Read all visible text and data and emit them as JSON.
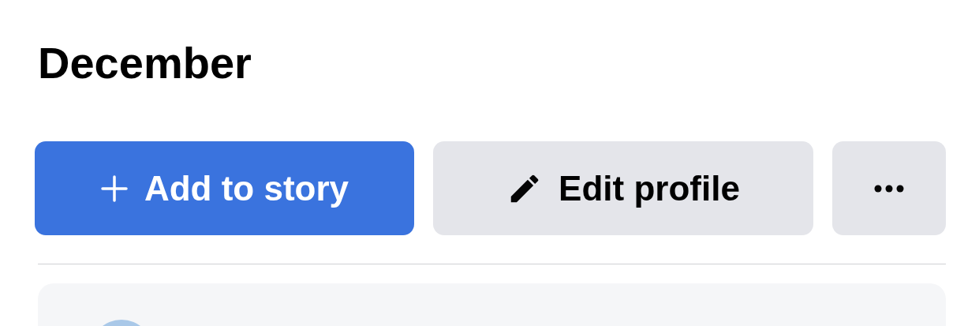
{
  "heading": "December",
  "buttons": [
    {
      "kind": "primary",
      "label": "Add to story"
    },
    {
      "kind": "secondary",
      "label": "Edit profile"
    },
    {
      "kind": "more"
    }
  ]
}
